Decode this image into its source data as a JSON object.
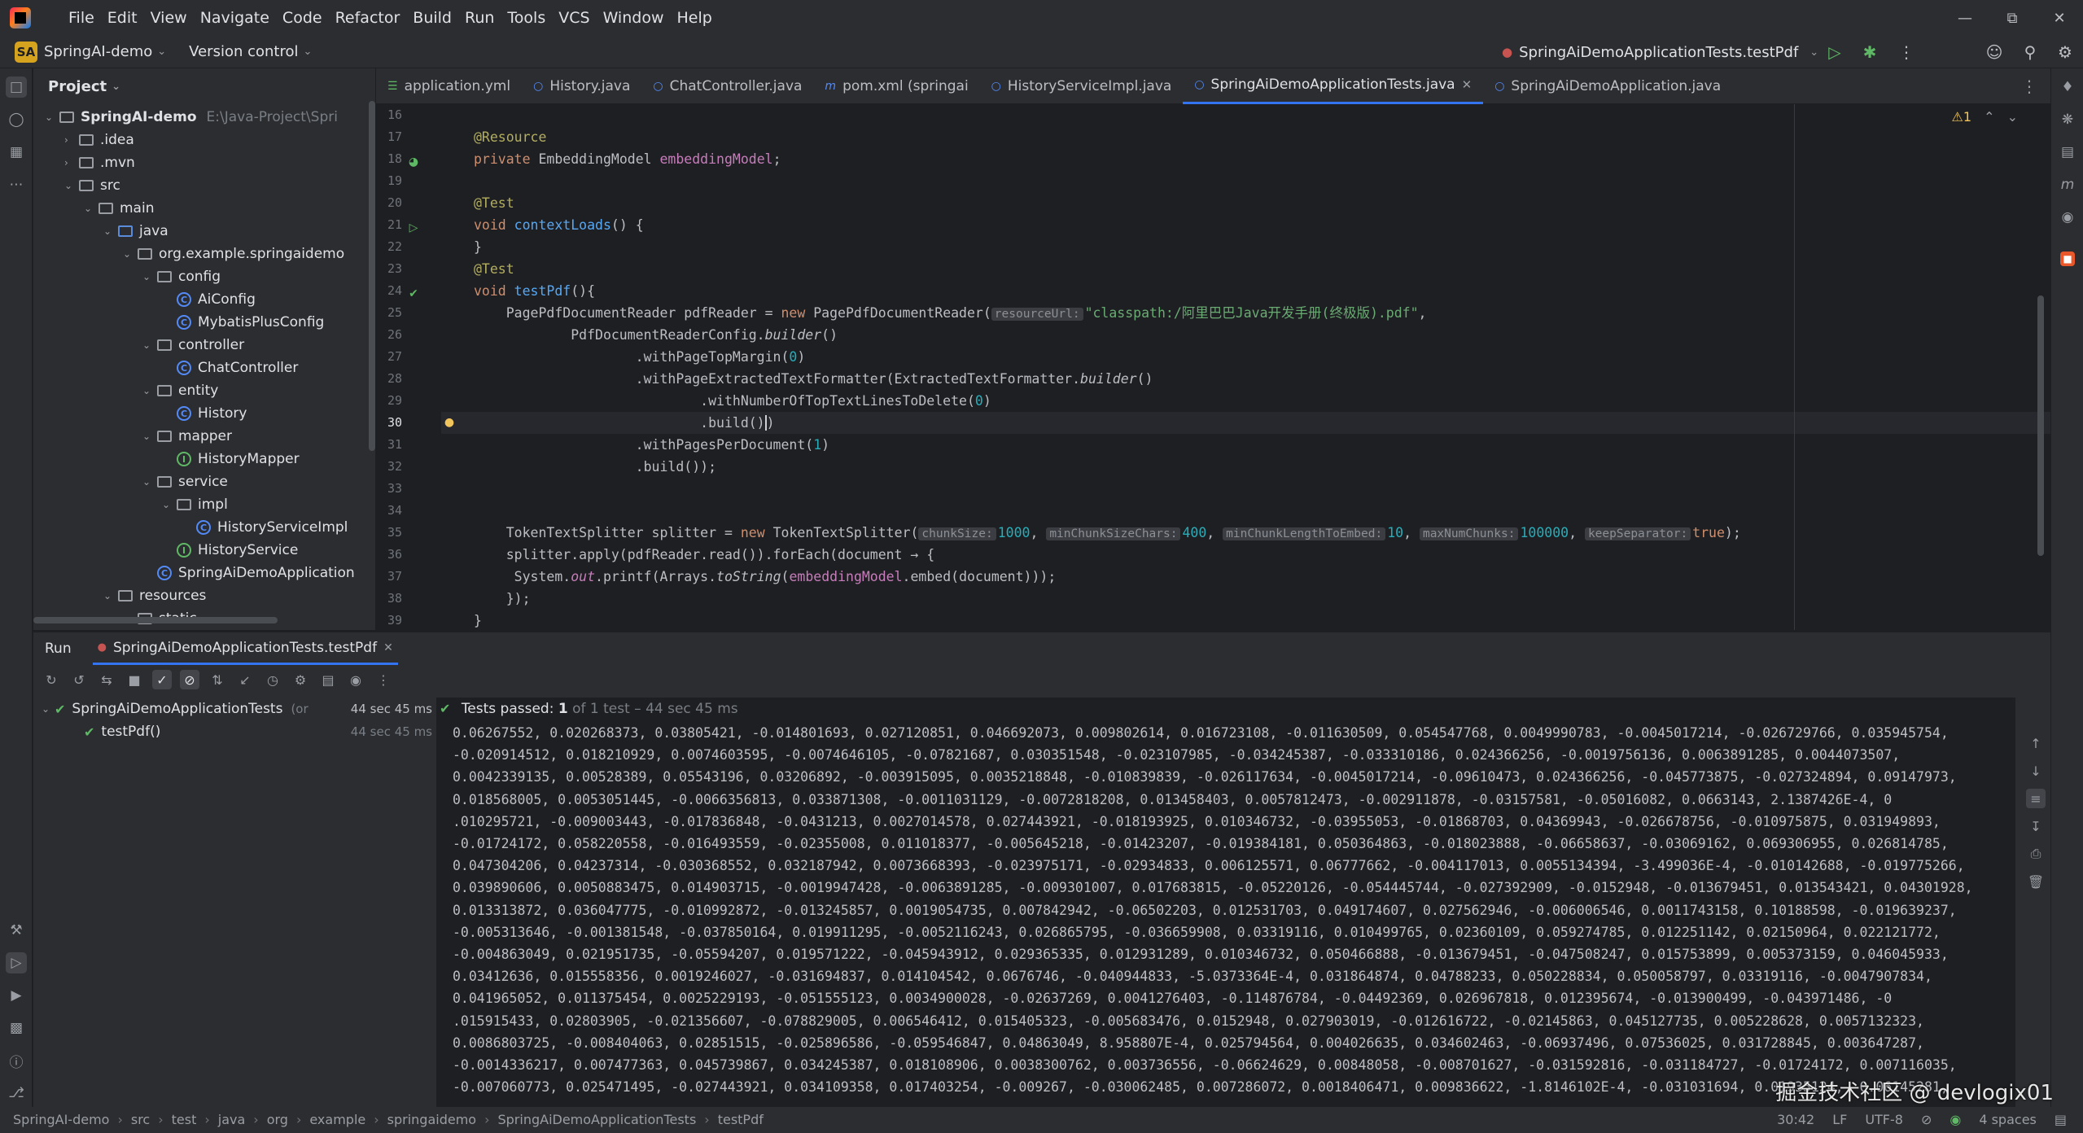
{
  "menu": [
    "File",
    "Edit",
    "View",
    "Navigate",
    "Code",
    "Refactor",
    "Build",
    "Run",
    "Tools",
    "VCS",
    "Window",
    "Help"
  ],
  "toolbar": {
    "project_badge": "SA",
    "project_name": "SpringAI-demo",
    "vcs": "Version control",
    "run_config": "SpringAiDemoApplicationTests.testPdf"
  },
  "project_panel": {
    "title": "Project",
    "root_name": "SpringAI-demo",
    "root_path": "E:\\Java-Project\\Spri",
    "items": [
      {
        "label": ".idea",
        "kind": "folder"
      },
      {
        "label": ".mvn",
        "kind": "folder"
      },
      {
        "label": "src",
        "kind": "folder"
      },
      {
        "label": "main",
        "kind": "folder"
      },
      {
        "label": "java",
        "kind": "folder-blue"
      },
      {
        "label": "org.example.springaidemo",
        "kind": "package"
      },
      {
        "label": "config",
        "kind": "package"
      },
      {
        "label": "AiConfig",
        "kind": "class"
      },
      {
        "label": "MybatisPlusConfig",
        "kind": "class"
      },
      {
        "label": "controller",
        "kind": "package"
      },
      {
        "label": "ChatController",
        "kind": "class"
      },
      {
        "label": "entity",
        "kind": "package"
      },
      {
        "label": "History",
        "kind": "class"
      },
      {
        "label": "mapper",
        "kind": "package"
      },
      {
        "label": "HistoryMapper",
        "kind": "interface"
      },
      {
        "label": "service",
        "kind": "package"
      },
      {
        "label": "impl",
        "kind": "package"
      },
      {
        "label": "HistoryServiceImpl",
        "kind": "class"
      },
      {
        "label": "HistoryService",
        "kind": "interface"
      },
      {
        "label": "SpringAiDemoApplication",
        "kind": "class"
      },
      {
        "label": "resources",
        "kind": "folder"
      },
      {
        "label": "static",
        "kind": "folder"
      }
    ]
  },
  "tabs": [
    {
      "label": "application.yml",
      "icon": "yaml-icon"
    },
    {
      "label": "History.java",
      "icon": "class-icon"
    },
    {
      "label": "ChatController.java",
      "icon": "class-icon"
    },
    {
      "label": "pom.xml (springai",
      "icon": "maven-icon"
    },
    {
      "label": "HistoryServiceImpl.java",
      "icon": "class-icon"
    },
    {
      "label": "SpringAiDemoApplicationTests.java",
      "icon": "class-icon",
      "active": true
    },
    {
      "label": "SpringAiDemoApplication.java",
      "icon": "class-icon"
    }
  ],
  "editor": {
    "warning_count": "1",
    "line_numbers": [
      "16",
      "17",
      "18",
      "19",
      "20",
      "21",
      "22",
      "23",
      "24",
      "25",
      "26",
      "27",
      "28",
      "29",
      "30",
      "31",
      "32",
      "33",
      "34",
      "35",
      "36",
      "37",
      "38",
      "39"
    ],
    "current_line": "30",
    "hints": {
      "resourceUrl": "resourceUrl:",
      "chunkSize": "chunkSize:",
      "minChunkSizeChars": "minChunkSizeChars:",
      "minChunkLengthToEmbed": "minChunkLengthToEmbed:",
      "maxNumChunks": "maxNumChunks:",
      "keepSeparator": "keepSeparator:"
    },
    "pdf_path": "\"classpath:/阿里巴巴Java开发手册(终极版).pdf\""
  },
  "run_panel": {
    "tab_run": "Run",
    "tab_config": "SpringAiDemoApplicationTests.testPdf",
    "suite_name": "SpringAiDemoApplicationTests",
    "suite_extra": "(or",
    "suite_duration": "44 sec 45 ms",
    "test_name": "testPdf()",
    "test_duration": "44 sec 45 ms",
    "passed_label": "Tests passed:",
    "passed_count": "1",
    "passed_rest": "of 1 test – 44 sec 45 ms",
    "output_lines": [
      "0.06267552, 0.020268373, 0.03805421, -0.014801693, 0.027120851, 0.046692073, 0.009802614, 0.016723108, -0.011630509, 0.054547768, 0.0049990783, -0.0045017214, -0.026729766, 0.035945754,",
      "-0.020914512, 0.018210929, 0.0074603595, -0.0074646105, -0.07821687, 0.030351548, -0.023107985, -0.034245387, -0.033310186, 0.024366256, -0.0019756136, 0.0063891285, 0.0044073507,",
      "0.0042339135, 0.00528389, 0.05543196, 0.03206892, -0.003915095, 0.0035218848, -0.010839839, -0.026117634, -0.0045017214, -0.09610473, 0.024366256, -0.045773875, -0.027324894, 0.09147973,",
      "0.018568005, 0.0053051445, -0.0066356813, 0.033871308, -0.0011031129, -0.0072818208, 0.013458403, 0.0057812473, -0.002911878, -0.03157581, -0.05016082, 0.0663143, 2.1387426E-4, 0",
      ".010295721, -0.009003443, -0.017836848, -0.0431213, 0.0027014578, 0.027443921, -0.018193925, 0.010346732, -0.03955053, -0.01868703, 0.04369943, -0.026678756, -0.010975875, 0.031949893,",
      "-0.01724172, 0.058220558, -0.016493559, -0.02355008, 0.011018377, -0.005645218, -0.01423207, -0.019384181, 0.050364863, -0.018023888, -0.06658637, -0.03069162, 0.069306955, 0.026814785,",
      "0.047304206, 0.04237314, -0.030368552, 0.032187942, 0.0073668393, -0.023975171, -0.02934833, 0.006125571, 0.06777662, -0.004117013, 0.0055134394, -3.499036E-4, -0.010142688, -0.019775266,",
      "0.039890606, 0.0050883475, 0.014903715, -0.0019947428, -0.0063891285, -0.009301007, 0.017683815, -0.05220126, -0.054445744, -0.027392909, -0.0152948, -0.013679451, 0.013543421, 0.04301928,",
      "0.013313872, 0.036047775, -0.010992872, -0.013245857, 0.0019054735, 0.007842942, -0.06502203, 0.012531703, 0.049174607, 0.027562946, -0.006006546, 0.0011743158, 0.10188598, -0.019639237,",
      "-0.005313646, -0.001381548, -0.037850164, 0.019911295, -0.0052116243, 0.026865795, -0.036659908, 0.03319116, 0.010499765, 0.02360109, 0.059274785, 0.012251142, 0.02150964, 0.022121772,",
      "-0.004863049, 0.021951735, -0.05594207, 0.019571222, -0.045943912, 0.029365335, 0.012931289, 0.010346732, 0.050466888, -0.013679451, -0.047508247, 0.015753899, 0.005373159, 0.046045933,",
      "0.03412636, 0.015558356, 0.0019246027, -0.031694837, 0.014104542, 0.0676746, -0.040944833, -5.0373364E-4, 0.031864874, 0.04788233, 0.050228834, 0.050058797, 0.03319116, -0.0047907834,",
      "0.041965052, 0.011375454, 0.0025229193, -0.051555123, 0.0034900028, -0.02637269, 0.0041276403, -0.114876784, -0.04492369, 0.026967818, 0.012395674, -0.013900499, -0.043971486, -0",
      ".015915433, 0.02803905, -0.021356607, -0.078829005, 0.006546412, 0.015405323, -0.005683476, 0.0152948, 0.027903019, -0.012616722, -0.02145863, 0.045127735, 0.005228628, 0.0057132323,",
      "0.0086803725, -0.008404063, 0.02851515, -0.025896586, -0.059546847, 0.04863049, 8.958807E-4, 0.025794564, 0.004026635, 0.034602463, -0.06937496, 0.07536025, 0.031728845, 0.003647287,",
      "-0.0014336217, 0.007477363, 0.045739867, 0.034245387, 0.018108906, 0.0038300762, 0.003736556, -0.06624629, 0.00848058, -0.008701627, -0.031592816, -0.031184727, -0.01724172, 0.007116035,",
      "-0.007060773, 0.025471495, -0.027443921, 0.034109358, 0.017403254, -0.009267, -0.030062485, 0.007286072, 0.0018406471, 0.009836622, -1.8146102E-4, -0.031031694, 0.01935124, -0.06145281,"
    ]
  },
  "statusbar": {
    "crumbs": [
      "SpringAI-demo",
      "src",
      "test",
      "java",
      "org",
      "example",
      "springaidemo",
      "SpringAiDemoApplicationTests",
      "testPdf"
    ],
    "position": "30:42",
    "line_sep": "LF",
    "encoding": "UTF-8",
    "indent": "4 spaces"
  },
  "watermark": "掘金技术社区 @ devlogix01"
}
